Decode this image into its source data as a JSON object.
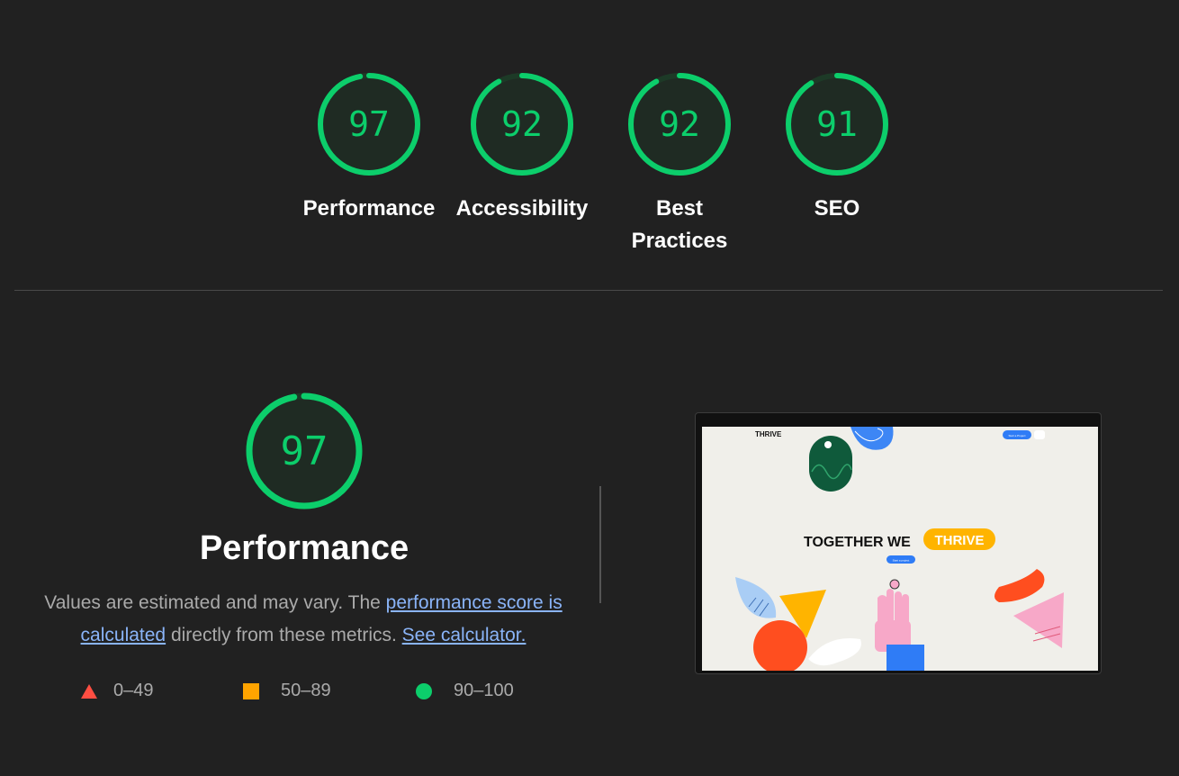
{
  "summary": [
    {
      "score": 97,
      "label": "Performance"
    },
    {
      "score": 92,
      "label": "Accessibility"
    },
    {
      "score": 92,
      "label_line1": "Best",
      "label_line2": "Practices"
    },
    {
      "score": 91,
      "label": "SEO"
    }
  ],
  "detail": {
    "score": 97,
    "title": "Performance",
    "desc_before": "Values are estimated and may vary. The ",
    "link1": "performance score is calculated",
    "desc_middle": " directly from these metrics. ",
    "link2": "See calculator."
  },
  "legend": [
    {
      "icon": "triangle-icon",
      "range": "0–49",
      "color": "#ff4e42"
    },
    {
      "icon": "square-icon",
      "range": "50–89",
      "color": "#ffa400"
    },
    {
      "icon": "circle-icon",
      "range": "90–100",
      "color": "#0cce6b"
    }
  ],
  "screenshot": {
    "brand": "THRIVE",
    "headline_part1": "TOGETHER WE",
    "headline_part2": "THRIVE",
    "cta_top": "Start a Project",
    "cta_main": "Start a project"
  },
  "colors": {
    "pass": "#0cce6b",
    "average": "#ffa400",
    "fail": "#ff4e42",
    "link": "#8ab4f8",
    "background": "#212121"
  }
}
